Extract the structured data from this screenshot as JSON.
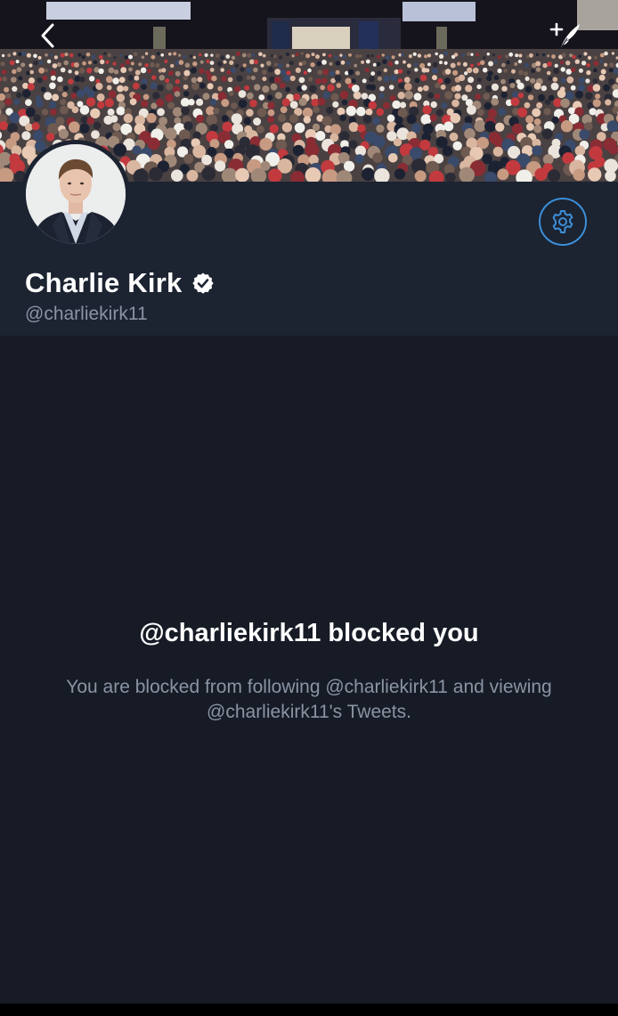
{
  "header": {
    "back_icon": "chevron-left-icon",
    "compose_icon": "compose-tweet-icon"
  },
  "profile": {
    "display_name": "Charlie Kirk",
    "handle": "@charliekirk11",
    "verified": true,
    "settings_icon": "gear-icon"
  },
  "blocked": {
    "title": "@charliekirk11 blocked you",
    "description": "You are blocked from following @charliekirk11 and viewing @charliekirk11's Tweets."
  },
  "colors": {
    "accent": "#3c8fd8",
    "background": "#161b26",
    "header_background": "#1c2331",
    "secondary_text": "#8a94a3"
  }
}
